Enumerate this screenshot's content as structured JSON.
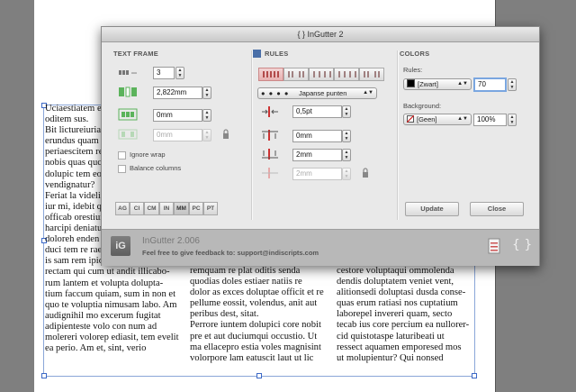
{
  "document": {
    "col1": [
      "Uciaestiatem e",
      "oditem sus.",
      "Bit lictureiuria",
      "erundus quam",
      "periaescitem re",
      "nobis quas quc",
      "dolupic tem eo",
      "vendignatur?",
      "Feriat la videlit",
      "iur mi, idebit q",
      "officab orestiur",
      "harcipi deniatu",
      "doloreh enden",
      "duci tem re rae",
      "is sam rem ipid ut autatatur",
      "rectam qui cum ut andit illicabo-",
      "rum lantem et volupta dolupta-",
      "tium faccum quiam, sum in non et",
      "quo te voluptia nimusam labo. Am",
      "audignihil mo excerum fugitat",
      "adipienteste volo con num ad",
      "molereri volorep ediasit, tem evelit",
      "ea perio. Am et, sint, verio"
    ],
    "col2": [
      "remquam re plat oditis senda",
      "quodias doles estiaer natiis re",
      "dolor as exces doluptae officit et re",
      "pellume eossit, volendus, anit aut",
      "peribus dest, sitat.",
      "Perrore iuntem dolupici core nobit",
      "pre et aut duciumqui occustio. Ut",
      "ma ellacepro estia voles magnisint",
      "volorpore lam eatuscit laut ut lic"
    ],
    "col3": [
      "cestore voluptaqui ommolenda",
      "dendis doluptatem veniet vent,",
      "alitionsedi doluptasi dusda conse-",
      "quas erum ratiasi nos cuptatium",
      "laborepel invereri quam, secto",
      "tecab ius core percium ea nullorer-",
      "cid quistotaspe laturibeati ut",
      "ressect aquamen emporesed mos",
      "ut molupientur? Qui nonsed"
    ]
  },
  "panel": {
    "title": "{ } InGutter 2",
    "text_frame": {
      "heading": "TEXT FRAME",
      "columns_value": "3",
      "gutter_value": "2,822mm",
      "inset_value": "0mm",
      "disabled_value": "0mm",
      "ignore_wrap": "Ignore wrap",
      "balance_columns": "Balance columns",
      "units": [
        "AG",
        "CI",
        "CM",
        "IN",
        "MM",
        "PC",
        "PT"
      ],
      "active_unit": "MM"
    },
    "rules": {
      "heading": "RULES",
      "style_label": "Japanse punten",
      "style_dots": "● ● ● ●",
      "weight_value": "0,5pt",
      "offset_top_value": "0mm",
      "offset_bottom_value": "2mm",
      "offset_disabled_value": "2mm"
    },
    "colors": {
      "heading": "COLORS",
      "rules_label": "Rules:",
      "rules_swatch": "[Zwart]",
      "rules_tint": "70",
      "background_label": "Background:",
      "background_swatch": "[Geen]",
      "background_tint": "100%",
      "black": "#000000",
      "none_red": "#d22222"
    },
    "buttons": {
      "update": "Update",
      "close": "Close"
    },
    "footer": {
      "logo": "iG",
      "product": "InGutter  2.006",
      "feedback": "Feel free to give feedback to: support@indiscripts.com"
    }
  }
}
